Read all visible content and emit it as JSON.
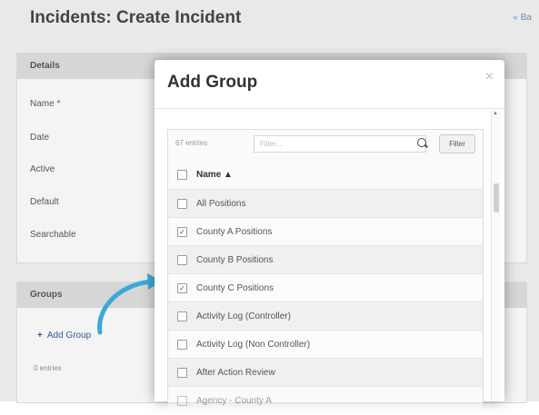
{
  "page": {
    "title": "Incidents: Create Incident",
    "back_label": "« Ba"
  },
  "details_panel": {
    "heading": "Details",
    "fields": [
      {
        "label": "Name",
        "required": true
      },
      {
        "label": "Date",
        "required": false
      },
      {
        "label": "Active",
        "required": false
      },
      {
        "label": "Default",
        "required": false
      },
      {
        "label": "Searchable",
        "required": false
      }
    ],
    "required_mark": "*"
  },
  "groups_panel": {
    "heading": "Groups",
    "add_label": "Add Group",
    "entries_label": "0 entries"
  },
  "modal": {
    "title": "Add Group",
    "close_glyph": "×",
    "entries_label": "67 entries",
    "filter_placeholder": "Filter...",
    "filter_button": "Filter",
    "column_header": "Name",
    "column_header_sort": "▲",
    "rows": [
      {
        "label": "All Positions",
        "checked": false
      },
      {
        "label": "County A Positions",
        "checked": true
      },
      {
        "label": "County B Positions",
        "checked": false
      },
      {
        "label": "County C Positions",
        "checked": true
      },
      {
        "label": "Activity Log (Controller)",
        "checked": false
      },
      {
        "label": "Activity Log (Non Controller)",
        "checked": false
      },
      {
        "label": "After Action Review",
        "checked": false
      },
      {
        "label": "Agency - County A",
        "checked": false
      }
    ]
  },
  "colors": {
    "accent_arrow": "#3aa9d8",
    "link": "#2e5d93"
  }
}
